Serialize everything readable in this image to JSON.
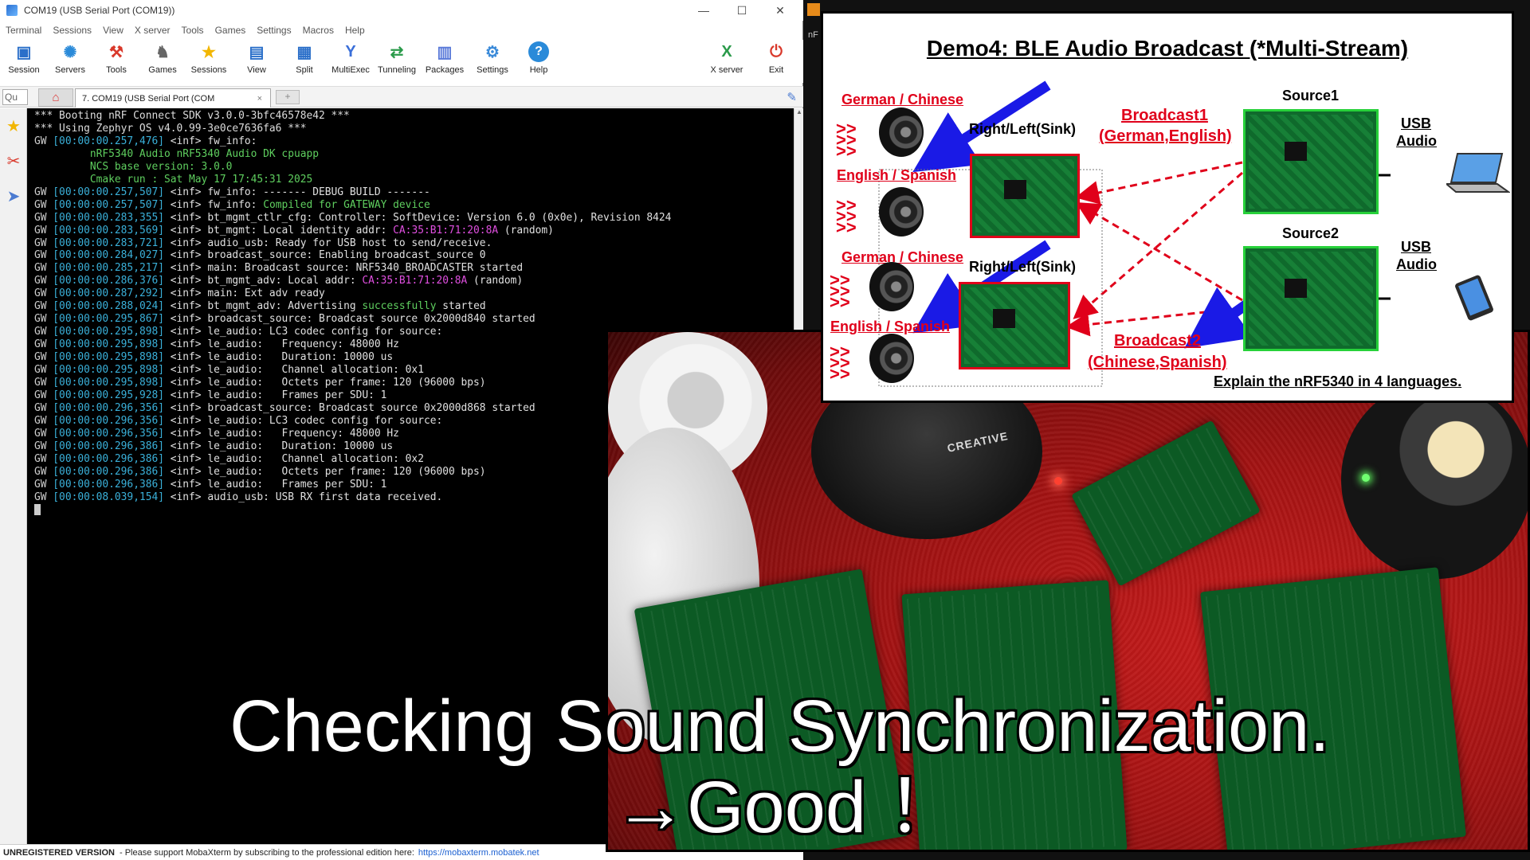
{
  "window": {
    "title": "COM19  (USB Serial Port (COM19))",
    "min": "—",
    "max": "☐",
    "close": "✕"
  },
  "menu": [
    "Terminal",
    "Sessions",
    "View",
    "X server",
    "Tools",
    "Games",
    "Settings",
    "Macros",
    "Help"
  ],
  "toolbar": [
    {
      "label": "Session",
      "icon": "session-icon",
      "color": "#2a6fc9"
    },
    {
      "label": "Servers",
      "icon": "servers-icon",
      "color": "#2a8ad9"
    },
    {
      "label": "Tools",
      "icon": "tools-icon",
      "color": "#d9382a"
    },
    {
      "label": "Games",
      "icon": "games-icon",
      "color": "#666666"
    },
    {
      "label": "Sessions",
      "icon": "star-icon",
      "color": "#f2b600"
    },
    {
      "label": "View",
      "icon": "view-icon",
      "color": "#2a6fc9"
    },
    {
      "label": "Split",
      "icon": "split-icon",
      "color": "#2a6fc9"
    },
    {
      "label": "MultiExec",
      "icon": "multiexec-icon",
      "color": "#3a6fd9"
    },
    {
      "label": "Tunneling",
      "icon": "tunneling-icon",
      "color": "#2a9a4a"
    },
    {
      "label": "Packages",
      "icon": "packages-icon",
      "color": "#5a7ad9"
    },
    {
      "label": "Settings",
      "icon": "settings-icon",
      "color": "#3a8ad9"
    },
    {
      "label": "Help",
      "icon": "help-icon",
      "color": "#2a8ad9"
    },
    {
      "label": "X server",
      "icon": "xserver-icon",
      "color": "#2a9a4a"
    },
    {
      "label": "Exit",
      "icon": "exit-icon",
      "color": "#d9382a"
    }
  ],
  "tabs": {
    "quick": "Qu",
    "session": "7. COM19  (USB Serial Port (COM",
    "close": "×",
    "new": "+"
  },
  "terminal": {
    "header": [
      "*** Booting nRF Connect SDK v3.0.0-3bfc46578e42 ***",
      "*** Using Zephyr OS v4.0.99-3e0ce7636fa6 ***"
    ],
    "lines": [
      {
        "ts": "[00:00:00.257,476]",
        "msg": " <inf> fw_info:"
      },
      {
        "ts": "",
        "msg": "         nRF5340 Audio nRF5340 Audio DK cpuapp",
        "cls": "g"
      },
      {
        "ts": "",
        "msg": "         NCS base version: 3.0.0",
        "cls": "g"
      },
      {
        "ts": "",
        "msg": "         Cmake run : Sat May 17 17:45:31 2025",
        "cls": "g"
      },
      {
        "ts": "[00:00:00.257,507]",
        "msg": " <inf> fw_info: ------- DEBUG BUILD -------"
      },
      {
        "ts": "[00:00:00.257,507]",
        "msg": " <inf> fw_info: ",
        "hl": "Compiled for GATEWAY device",
        "hcls": "g"
      },
      {
        "ts": "[00:00:00.283,355]",
        "msg": " <inf> bt_mgmt_ctlr_cfg: Controller: SoftDevice: Version 6.0 (0x0e), Revision 8424"
      },
      {
        "ts": "[00:00:00.283,569]",
        "msg": " <inf> bt_mgmt: Local identity addr: ",
        "hl": "CA:35:B1:71:20:8A",
        "hcls": "m",
        "tail": " (random)"
      },
      {
        "ts": "[00:00:00.283,721]",
        "msg": " <inf> audio_usb: Ready for USB host to send/receive."
      },
      {
        "ts": "[00:00:00.284,027]",
        "msg": " <inf> broadcast_source: Enabling broadcast_source 0"
      },
      {
        "ts": "[00:00:00.285,217]",
        "msg": " <inf> main: Broadcast source: NRF5340_BROADCASTER started"
      },
      {
        "ts": "[00:00:00.286,376]",
        "msg": " <inf> bt_mgmt_adv: Local addr: ",
        "hl": "CA:35:B1:71:20:8A",
        "hcls": "m",
        "tail": " (random)"
      },
      {
        "ts": "[00:00:00.287,292]",
        "msg": " <inf> main: Ext adv ready"
      },
      {
        "ts": "[00:00:00.288,024]",
        "msg": " <inf> bt_mgmt_adv: Advertising ",
        "hl": "successfully",
        "hcls": "g",
        "tail": " started"
      },
      {
        "ts": "[00:00:00.295,867]",
        "msg": " <inf> broadcast_source: Broadcast source 0x2000d840 started"
      },
      {
        "ts": "[00:00:00.295,898]",
        "msg": " <inf> le_audio: LC3 codec config for source:"
      },
      {
        "ts": "[00:00:00.295,898]",
        "msg": " <inf> le_audio:   Frequency: 48000 Hz"
      },
      {
        "ts": "[00:00:00.295,898]",
        "msg": " <inf> le_audio:   Duration: 10000 us"
      },
      {
        "ts": "[00:00:00.295,898]",
        "msg": " <inf> le_audio:   Channel allocation: 0x1"
      },
      {
        "ts": "[00:00:00.295,898]",
        "msg": " <inf> le_audio:   Octets per frame: 120 (96000 bps)"
      },
      {
        "ts": "[00:00:00.295,928]",
        "msg": " <inf> le_audio:   Frames per SDU: 1"
      },
      {
        "ts": "[00:00:00.296,356]",
        "msg": " <inf> broadcast_source: Broadcast source 0x2000d868 started"
      },
      {
        "ts": "[00:00:00.296,356]",
        "msg": " <inf> le_audio: LC3 codec config for source:"
      },
      {
        "ts": "[00:00:00.296,356]",
        "msg": " <inf> le_audio:   Frequency: 48000 Hz"
      },
      {
        "ts": "[00:00:00.296,386]",
        "msg": " <inf> le_audio:   Duration: 10000 us"
      },
      {
        "ts": "[00:00:00.296,386]",
        "msg": " <inf> le_audio:   Channel allocation: 0x2"
      },
      {
        "ts": "[00:00:00.296,386]",
        "msg": " <inf> le_audio:   Octets per frame: 120 (96000 bps)"
      },
      {
        "ts": "[00:00:00.296,386]",
        "msg": " <inf> le_audio:   Frames per SDU: 1"
      },
      {
        "ts": "[00:00:08.039,154]",
        "msg": " <inf> audio_usb: USB RX first data received."
      }
    ]
  },
  "status": {
    "tag": "UNREGISTERED VERSION",
    "text": "-  Please support MobaXterm by subscribing to the professional edition here:",
    "link": "https://mobaxterm.mobatek.net"
  },
  "right_tab": "nF",
  "diagram": {
    "title": "Demo4: BLE Audio Broadcast (*Multi-Stream)",
    "german_chinese_1": "German / Chinese",
    "english_spanish_1": "English / Spanish",
    "german_chinese_2": "German / Chinese",
    "english_spanish_2": "English / Spanish",
    "sink1": "Right/Left(Sink)",
    "sink2": "Right/Left(Sink)",
    "broadcast1": "Broadcast1",
    "broadcast1_langs": "(German,English)",
    "broadcast2": "Broadcast2",
    "broadcast2_langs": "(Chinese,Spanish)",
    "source1": "Source1",
    "source2": "Source2",
    "usb_audio_1": [
      "USB",
      "Audio"
    ],
    "usb_audio_2": [
      "USB",
      "Audio"
    ],
    "explain": "Explain the nRF5340 in 4 languages."
  },
  "photo": {
    "brand": "CREATIVE"
  },
  "caption": {
    "line1": "Checking Sound Synchronization.",
    "line2": "→Good ！"
  }
}
